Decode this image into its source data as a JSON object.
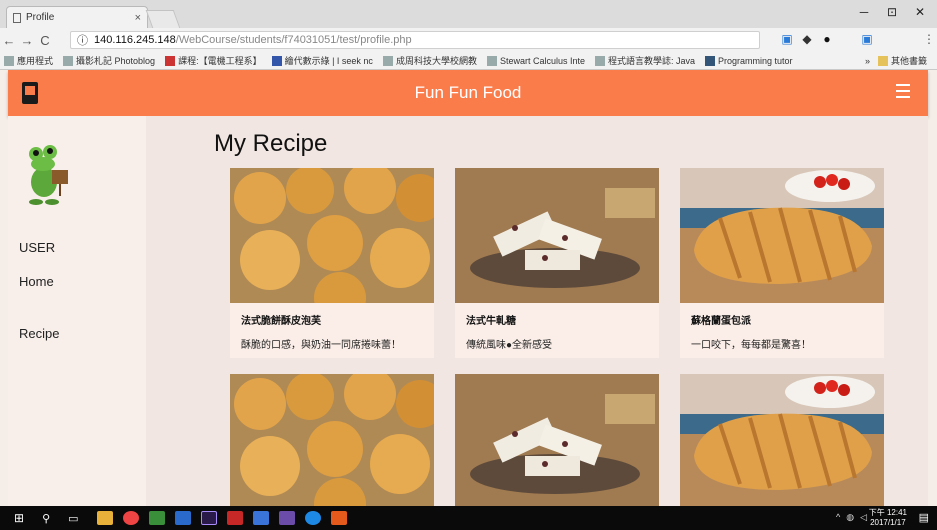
{
  "browser": {
    "tab_title": "Profile",
    "tab_close": "×",
    "url_host": "140.116.245.148",
    "url_path": "/WebCourse/students/f74031051/test/profile.php",
    "bookmarks": [
      "應用程式",
      "攝影札記 Photoblog",
      "課程:【電機工程系】",
      "繪代數示綠 | I seek nc",
      "成周科技大學校網教",
      "Stewart Calculus Inte",
      "程式語言教學誌: Java",
      "Programming tutor"
    ],
    "bookmarks_more": "»",
    "bookmarks_other": "其他書籤",
    "win_min": "─",
    "win_max": "⊡",
    "win_close": "✕",
    "nav_back": "←",
    "nav_forward": "→",
    "nav_reload": "C",
    "info_icon": "ⓘ"
  },
  "header": {
    "site_title": "Fun Fun Food"
  },
  "sidebar": {
    "items": [
      {
        "label": "USER"
      },
      {
        "label": "Home"
      },
      {
        "label": "Recipe"
      }
    ]
  },
  "main": {
    "title": "My Recipe",
    "cards": [
      {
        "name": "法式脆餅酥皮泡芙",
        "desc": "酥脆的口感，與奶油一同席捲味蕾！",
        "image": "cream-puffs"
      },
      {
        "name": "法式牛軋糖",
        "desc": "傳統風味●全新感受",
        "image": "nougat"
      },
      {
        "name": "蘇格蘭蛋包派",
        "desc": "一口咬下，每每都是驚喜！",
        "image": "pie"
      }
    ]
  },
  "taskbar": {
    "time": "下午 12:41",
    "date": "2017/1/17"
  }
}
